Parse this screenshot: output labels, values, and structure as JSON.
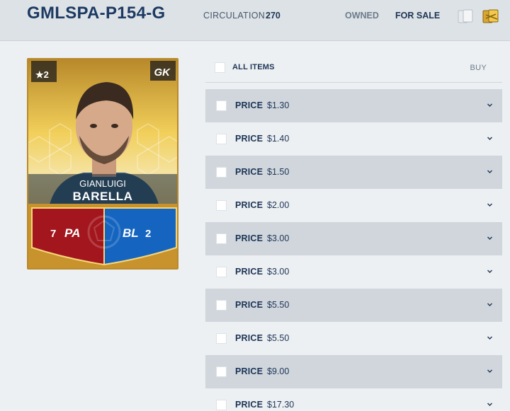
{
  "header": {
    "title": "GMLSPA-P154-G",
    "circulation_label": "CIRCULATION",
    "circulation_value": "270",
    "tabs": {
      "owned": "OWNED",
      "for_sale": "FOR SALE"
    },
    "icons": [
      "cards-stack-icon",
      "gold-cards-icon"
    ]
  },
  "card": {
    "stars": "★2",
    "position": "GK",
    "first_name": "GIANLUIGI",
    "last_name": "BARELLA",
    "stat_left_value": "7",
    "stat_left_label": "PA",
    "stat_right_label": "BL",
    "stat_right_value": "2",
    "colors": {
      "gold": "#f1cf5a",
      "red": "#a3161d",
      "blue": "#1565c0"
    }
  },
  "list": {
    "all_items_label": "ALL ITEMS",
    "buy_label": "BUY",
    "price_label": "PRICE",
    "rows": [
      {
        "price": "$1.30"
      },
      {
        "price": "$1.40"
      },
      {
        "price": "$1.50"
      },
      {
        "price": "$2.00"
      },
      {
        "price": "$3.00"
      },
      {
        "price": "$3.00"
      },
      {
        "price": "$5.50"
      },
      {
        "price": "$5.50"
      },
      {
        "price": "$9.00"
      },
      {
        "price": "$17.30"
      }
    ]
  }
}
